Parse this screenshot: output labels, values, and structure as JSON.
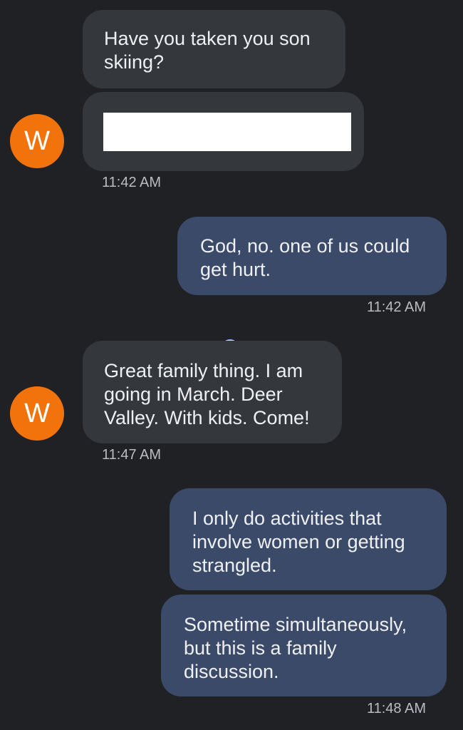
{
  "conversation": {
    "contact_initial": "W",
    "messages": [
      {
        "sender": "incoming",
        "text": "Have you taken you son\nskiing?"
      },
      {
        "sender": "incoming",
        "text": "",
        "redacted": true
      },
      {
        "sender": "outgoing",
        "text": "God, no. one of us could\nget hurt."
      },
      {
        "sender": "incoming",
        "text": "Great family thing. I am\ngoing in March. Deer\nValley. With kids. Come!"
      },
      {
        "sender": "outgoing",
        "text": "I only do activities that\ninvolve women or getting\nstrangled."
      },
      {
        "sender": "outgoing",
        "text": "Sometime simultaneously,\nbut this is a family\ndiscussion."
      }
    ],
    "timestamps": [
      "11:42 AM",
      "11:42 AM",
      "11:47 AM",
      "11:48 AM"
    ]
  },
  "colors": {
    "background": "#202125",
    "incoming_bubble": "#34373b",
    "outgoing_bubble": "#3b4a68",
    "avatar": "#f2720c",
    "timestamp": "#b9bcc1",
    "loading_indicator": "#a8c4f2"
  },
  "icons": {
    "loading": "loading-spinner-icon"
  }
}
